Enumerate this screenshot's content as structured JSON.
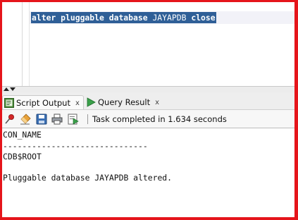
{
  "editor": {
    "sql_keywords": "alter pluggable database ",
    "sql_identifier": "JAYAPDB",
    "sql_tail": " close"
  },
  "tabs": [
    {
      "label": "Script Output",
      "close": "x",
      "active": true
    },
    {
      "label": "Query Result",
      "close": "x",
      "active": false
    }
  ],
  "toolbar": {
    "status": "Task completed in 1.634 seconds"
  },
  "output": {
    "lines": [
      "CON_NAME",
      "------------------------------",
      "CDB$ROOT",
      "",
      "Pluggable database JAYAPDB altered."
    ]
  },
  "colors": {
    "frame": "#e5151b",
    "selection": "#2f5f97",
    "run_green": "#3aa04a"
  },
  "icons": {
    "splitter": [
      "collapse-up-icon",
      "expand-down-icon"
    ],
    "tabs": [
      "script-output-icon",
      "query-result-run-icon"
    ],
    "toolbar": [
      "pin-icon",
      "eraser-icon",
      "save-icon",
      "print-icon",
      "run-script-icon"
    ]
  }
}
